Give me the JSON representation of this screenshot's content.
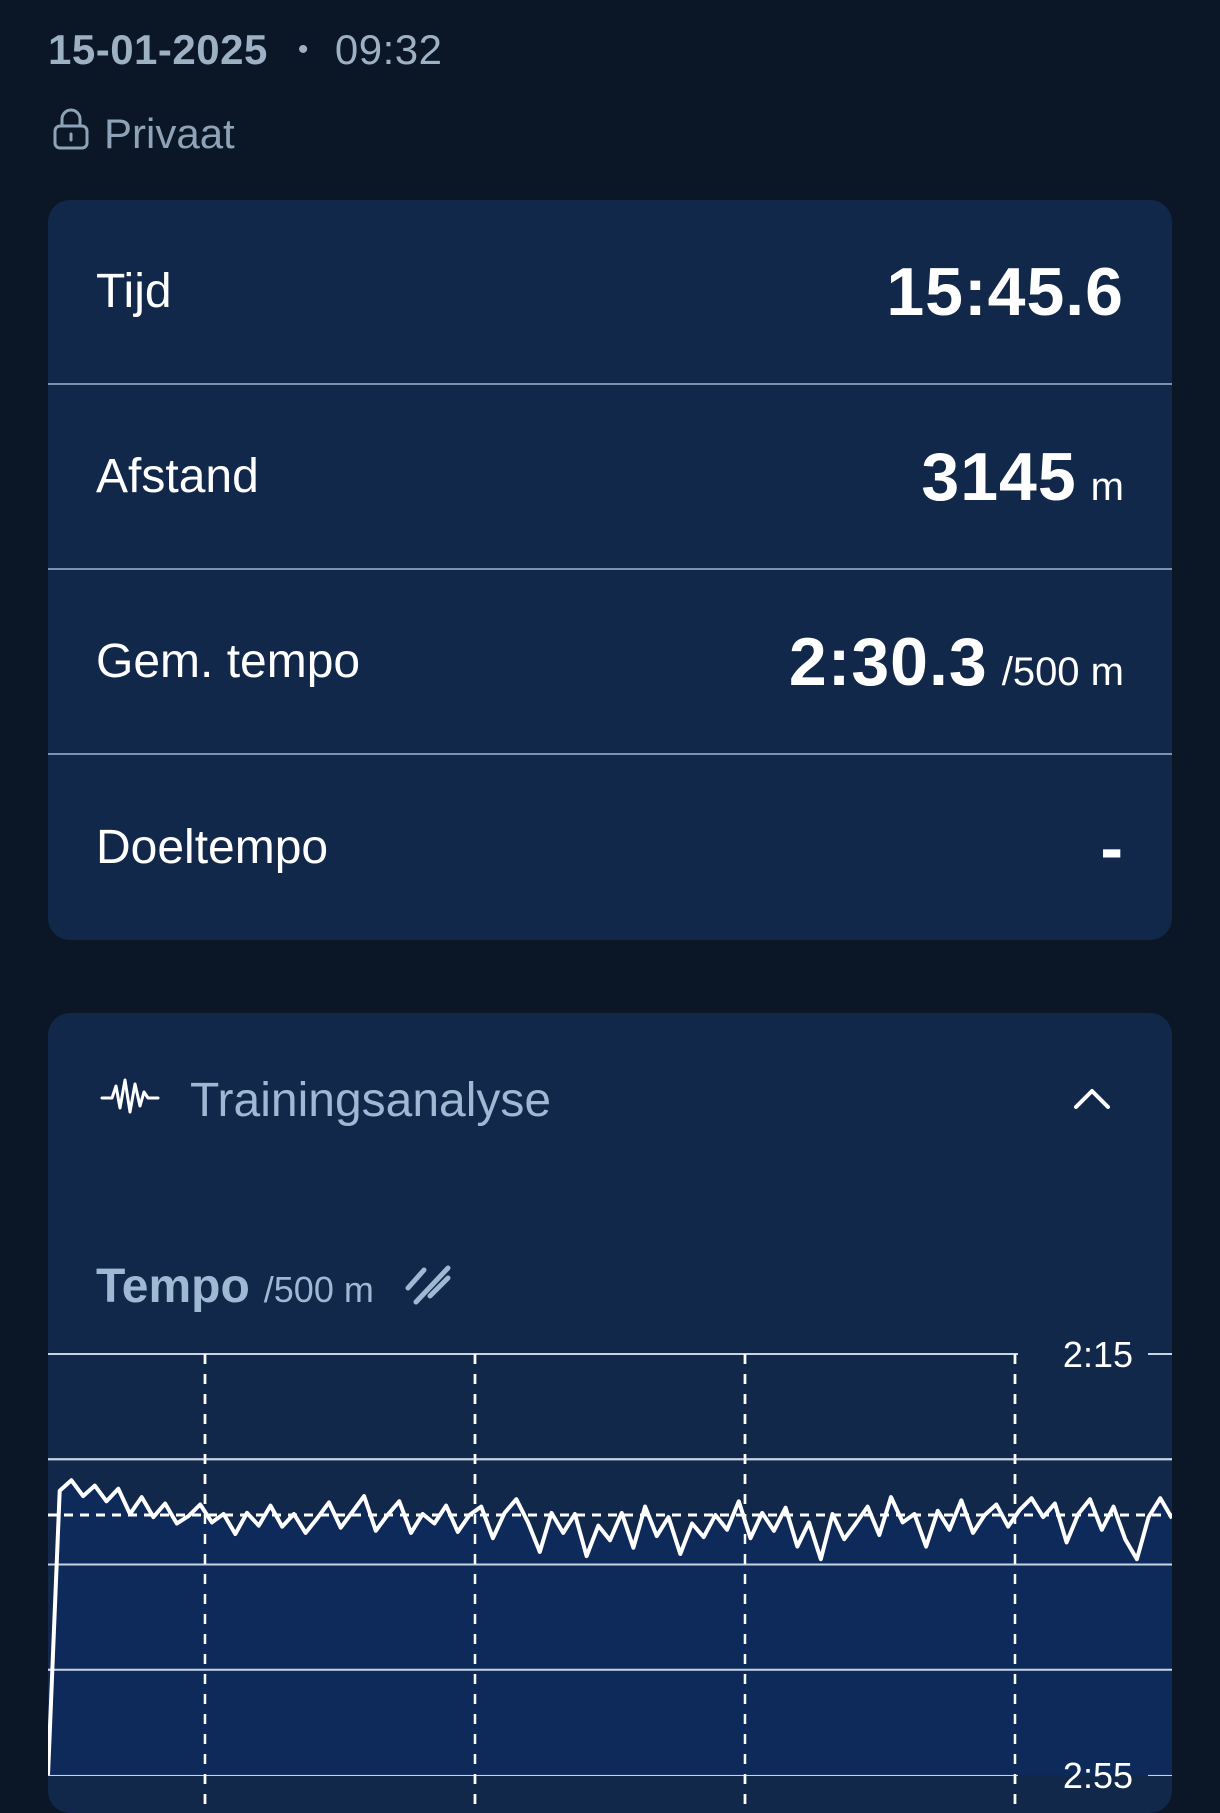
{
  "header": {
    "date": "15-01-2025",
    "separator": "•",
    "time": "09:32",
    "privacy_label": "Privaat"
  },
  "stats": [
    {
      "label": "Tijd",
      "value": "15:45.6",
      "unit": ""
    },
    {
      "label": "Afstand",
      "value": "3145",
      "unit": "m"
    },
    {
      "label": "Gem. tempo",
      "value": "2:30.3",
      "unit": "/500 m"
    },
    {
      "label": "Doeltempo",
      "value": "-",
      "unit": ""
    }
  ],
  "analysis": {
    "title": "Trainingsanalyse",
    "chart_title": "Tempo",
    "chart_unit": "/500 m"
  },
  "colors": {
    "background": "#0b1727",
    "card": "#11284a",
    "accent_text": "#9fb8d3",
    "area_fill": "#0f2a5c"
  },
  "icons": [
    "lock-icon",
    "activity-wave-icon",
    "chevron-up-icon",
    "trend-toggle-icon"
  ],
  "chart_data": {
    "type": "area",
    "title": "Tempo",
    "ylabel": "/500 m",
    "y_inverted": true,
    "yticks": [
      "2:15",
      "2:55"
    ],
    "ylim_seconds": [
      135,
      175
    ],
    "reference_line_seconds": 150.3,
    "grid": true,
    "series": [
      {
        "values_seconds": [
          175,
          148,
          147,
          148.5,
          147.5,
          149,
          147.8,
          150.2,
          148.6,
          150.5,
          149.2,
          151.1,
          150.4,
          149.3,
          151,
          150.2,
          152.1,
          150.1,
          151.3,
          149.4,
          151.4,
          150.2,
          152,
          150.6,
          149.1,
          151.5,
          150,
          148.5,
          151.8,
          150.3,
          149,
          152,
          150.2,
          151.1,
          149.4,
          151.9,
          150.3,
          149.5,
          152.5,
          150.1,
          148.8,
          151,
          153.8,
          150.1,
          152,
          150.2,
          154.2,
          151.3,
          152.7,
          150.1,
          153.4,
          149.5,
          152.3,
          150.5,
          154,
          151.1,
          152.4,
          150.3,
          151.7,
          149,
          152.5,
          150.1,
          151.8,
          149.6,
          153.3,
          151,
          154.5,
          150.2,
          152.6,
          151.1,
          149.5,
          152.2,
          148.6,
          151,
          150.2,
          153.3,
          149.9,
          151.7,
          148.9,
          152,
          150.3,
          149.3,
          151.4,
          149.8,
          148.7,
          150.5,
          149.2,
          152.9,
          150.2,
          148.8,
          151.7,
          149.5,
          152.6,
          154.5,
          150.5,
          148.7,
          150.6
        ]
      }
    ]
  }
}
